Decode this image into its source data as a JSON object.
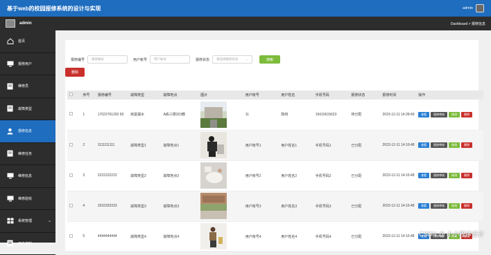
{
  "header": {
    "title": "基于web的校园报修系统的设计与实现",
    "user": "admin"
  },
  "subbar": {
    "user": "admin",
    "breadcrumb": "Dashboard > 报修信息"
  },
  "sidebar": {
    "items": [
      {
        "label": "首页",
        "icon": "home-icon"
      },
      {
        "label": "报修用户",
        "icon": "monitor-icon"
      },
      {
        "label": "维修员",
        "icon": "document-icon"
      },
      {
        "label": "故障类型",
        "icon": "document-icon"
      },
      {
        "label": "报修信息",
        "icon": "user-icon",
        "active": true
      },
      {
        "label": "维修任务",
        "icon": "document-icon"
      },
      {
        "label": "维修信息",
        "icon": "monitor-icon"
      },
      {
        "label": "维修验收",
        "icon": "monitor-icon"
      },
      {
        "label": "系统管理",
        "icon": "grid-icon",
        "chevron": true
      },
      {
        "label": "用户资料",
        "icon": "document-icon",
        "chevron": true
      }
    ]
  },
  "search": {
    "field1_label": "报修编号",
    "field1_placeholder": "报修编号",
    "field2_label": "用户帐号",
    "field2_placeholder": "用户帐号",
    "field3_label": "报修状态",
    "field3_placeholder": "请选择报修状态",
    "search_button": "搜索"
  },
  "delete_button": "删除",
  "table": {
    "headers": [
      "序号",
      "报修编号",
      "故障类型",
      "故障地点",
      "图片",
      "用户帐号",
      "用户姓名",
      "手机号码",
      "报修状态",
      "报修时间",
      "操作"
    ],
    "rows": [
      {
        "no": "1",
        "code": "17022761292 83",
        "type": "房屋漏水",
        "place": "A栋三楼203教",
        "account": "11",
        "name": "陈晓",
        "phone": "15615615623",
        "status": "待分配",
        "time": "2023-12-11 14:28:49"
      },
      {
        "no": "2",
        "code": "1111111111",
        "type": "故障类型1",
        "place": "故障地点1",
        "account": "用户帐号1",
        "name": "用户姓名1",
        "phone": "手机号码1",
        "status": "已分配",
        "time": "2023-12-11 14:16:48"
      },
      {
        "no": "3",
        "code": "2222222222",
        "type": "故障类型2",
        "place": "故障地点2",
        "account": "用户帐号2",
        "name": "用户姓名2",
        "phone": "手机号码2",
        "status": "已分配",
        "time": "2023-12-11 14:16:48"
      },
      {
        "no": "4",
        "code": "3333333333",
        "type": "故障类型3",
        "place": "故障地点3",
        "account": "用户帐号3",
        "name": "用户姓名3",
        "phone": "手机号码3",
        "status": "已分配",
        "time": "2023-12-11 14:16:48"
      },
      {
        "no": "5",
        "code": "4444444444",
        "type": "故障类型4",
        "place": "故障地点4",
        "account": "用户帐号4",
        "name": "用户姓名4",
        "phone": "手机号码4",
        "status": "已分配",
        "time": "2023-12-11 14:16:48"
      }
    ],
    "ops": {
      "view": "查看",
      "audit": "报修审核",
      "edit": "修改",
      "delete": "删除"
    }
  },
  "watermark": "CSDN @ 小小程序设计"
}
